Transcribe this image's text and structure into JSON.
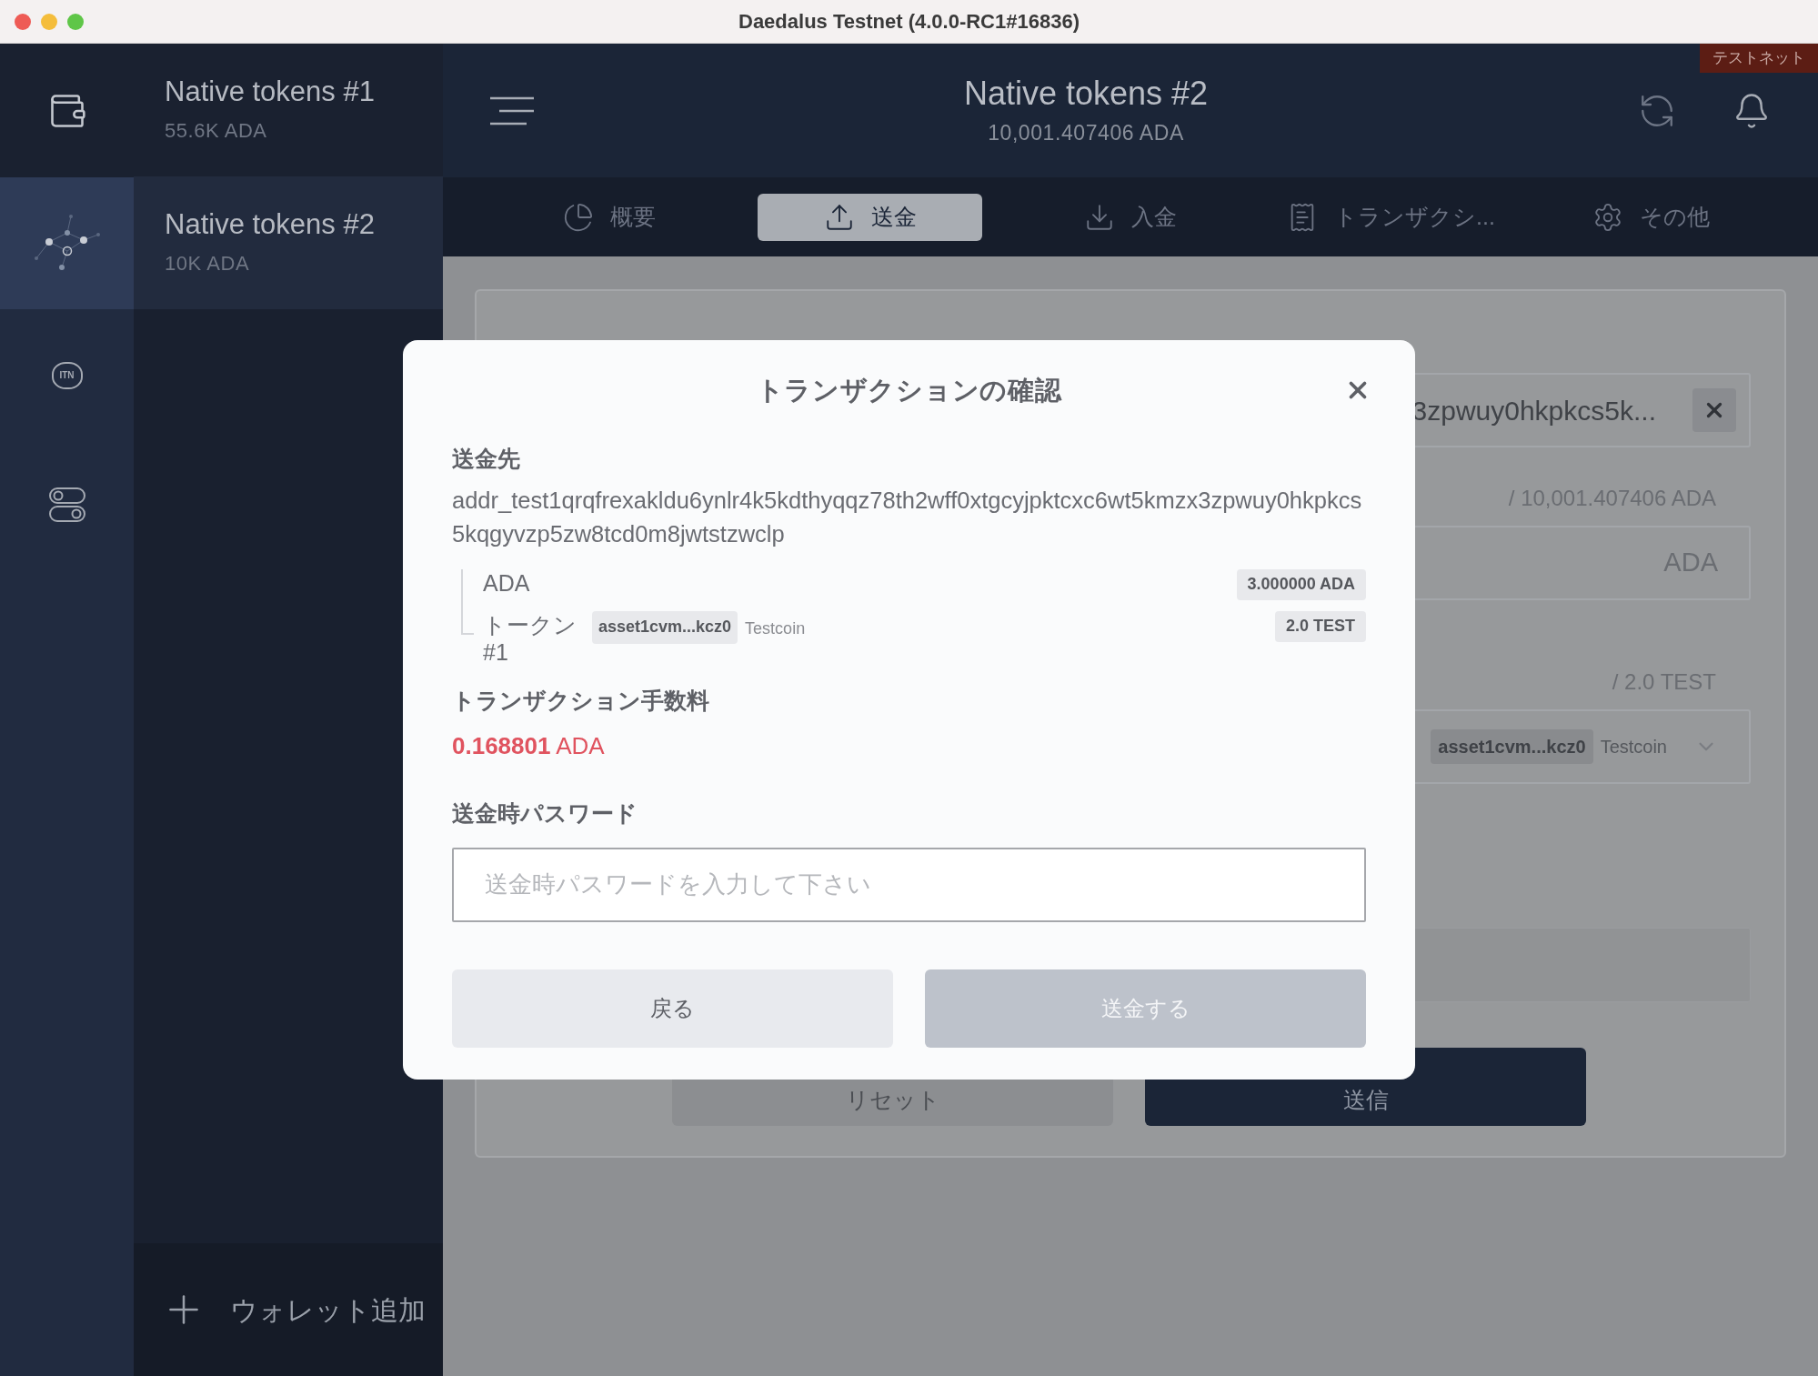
{
  "window": {
    "title": "Daedalus Testnet (4.0.0-RC1#16836)"
  },
  "sidebar": {
    "items": [
      {
        "kind": "wallets",
        "selected": false
      },
      {
        "kind": "network",
        "selected": true
      },
      {
        "kind": "itn",
        "label": "ITN",
        "selected": false
      },
      {
        "kind": "toggles",
        "selected": false
      }
    ]
  },
  "wallets": [
    {
      "name": "Native tokens #1",
      "balance": "55.6K ADA",
      "selected": false
    },
    {
      "name": "Native tokens #2",
      "balance": "10K ADA",
      "selected": true
    }
  ],
  "add_wallet": "ウォレット追加",
  "testnet_badge": "テストネット",
  "header": {
    "wallet_name": "Native tokens #2",
    "balance": "10,001.407406 ADA"
  },
  "tabs": [
    {
      "kind": "summary",
      "label": "概要",
      "selected": false
    },
    {
      "kind": "send",
      "label": "送金",
      "selected": true
    },
    {
      "kind": "receive",
      "label": "入金",
      "selected": false
    },
    {
      "kind": "transactions",
      "label": "トランザクシ...",
      "selected": false
    },
    {
      "kind": "more",
      "label": "その他",
      "selected": false
    }
  ],
  "send_form": {
    "address_value": "3zpwuy0hkpkcs5k...",
    "ada_total": "/ 10,001.407406 ADA",
    "ada_unit": "ADA",
    "token_total": "/ 2.0 TEST",
    "token_asset": "asset1cvm...kcz0",
    "token_name": "Testcoin",
    "buttons": [
      {
        "label": "リセット",
        "kind": "secondary"
      },
      {
        "label": "送信",
        "kind": "primary"
      }
    ]
  },
  "dialog": {
    "title": "トランザクションの確認",
    "receiver_label": "送金先",
    "address": "addr_test1qrqfrexakldu6ynlr4k5kdthyqqz78th2wff0xtgcyjpktcxc6wt5kmzx3zpwuy0hkpkcs5kqgyvzp5zw8tcd0m8jwtstzwclp",
    "assets": [
      {
        "label": "ADA",
        "amount": "3.000000 ADA"
      },
      {
        "label": "トークン #1",
        "asset": "asset1cvm...kcz0",
        "name": "Testcoin",
        "amount": "2.0 TEST"
      }
    ],
    "fee_label": "トランザクション手数料",
    "fee_value": "0.168801",
    "fee_unit": "ADA",
    "password_label": "送金時パスワード",
    "password_placeholder": "送金時パスワードを入力して下さい",
    "buttons": [
      {
        "label": "戻る",
        "kind": "secondary",
        "disabled": false
      },
      {
        "label": "送金する",
        "kind": "primary",
        "disabled": true
      }
    ]
  }
}
